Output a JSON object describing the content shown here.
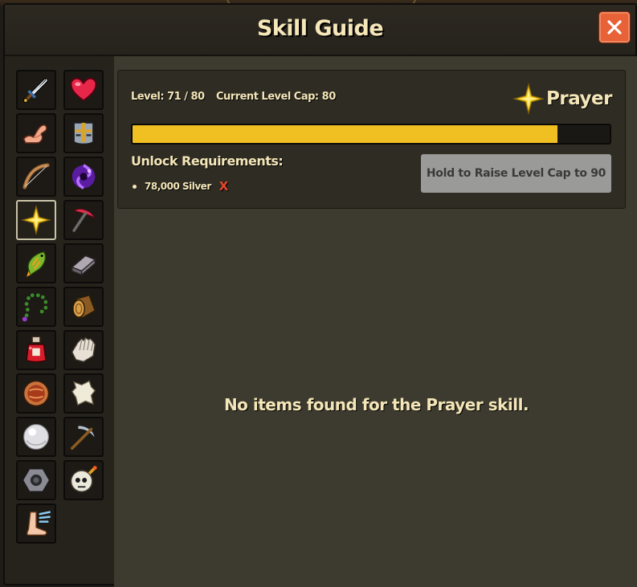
{
  "window": {
    "title": "Skill Guide",
    "close_icon": "close-icon"
  },
  "sidebar": {
    "skills": [
      {
        "icon": "sword-icon"
      },
      {
        "icon": "heart-icon"
      },
      {
        "icon": "flexed-arm-icon"
      },
      {
        "icon": "helmet-icon"
      },
      {
        "icon": "bow-icon"
      },
      {
        "icon": "magic-orb-icon"
      },
      {
        "icon": "prayer-star-icon",
        "selected": true
      },
      {
        "icon": "pickaxe-icon"
      },
      {
        "icon": "fish-icon"
      },
      {
        "icon": "metal-bar-icon"
      },
      {
        "icon": "bead-necklace-icon"
      },
      {
        "icon": "log-icon"
      },
      {
        "icon": "potion-icon"
      },
      {
        "icon": "glove-icon"
      },
      {
        "icon": "pie-icon"
      },
      {
        "icon": "leather-hide-icon"
      },
      {
        "icon": "pearl-icon"
      },
      {
        "icon": "scythe-icon"
      },
      {
        "icon": "bolt-nut-icon"
      },
      {
        "icon": "skull-bomb-icon"
      },
      {
        "icon": "winged-foot-icon"
      }
    ]
  },
  "skill_panel": {
    "level_text": "Level: 71 / 80",
    "cap_text": "Current Level Cap: 80",
    "skill_name": "Prayer",
    "progress_fraction": 0.89,
    "unlock_title": "Unlock Requirements:",
    "requirements": [
      {
        "text": "78,000 Silver",
        "status": "X"
      }
    ],
    "raise_button_label": "Hold to Raise Level Cap to 90"
  },
  "empty_message": "No items found for the Prayer skill.",
  "colors": {
    "accent_gold": "#f0c022",
    "close_button": "#e86238",
    "text_cream": "#f4e6b8",
    "requirement_unmet": "#e8462b"
  }
}
